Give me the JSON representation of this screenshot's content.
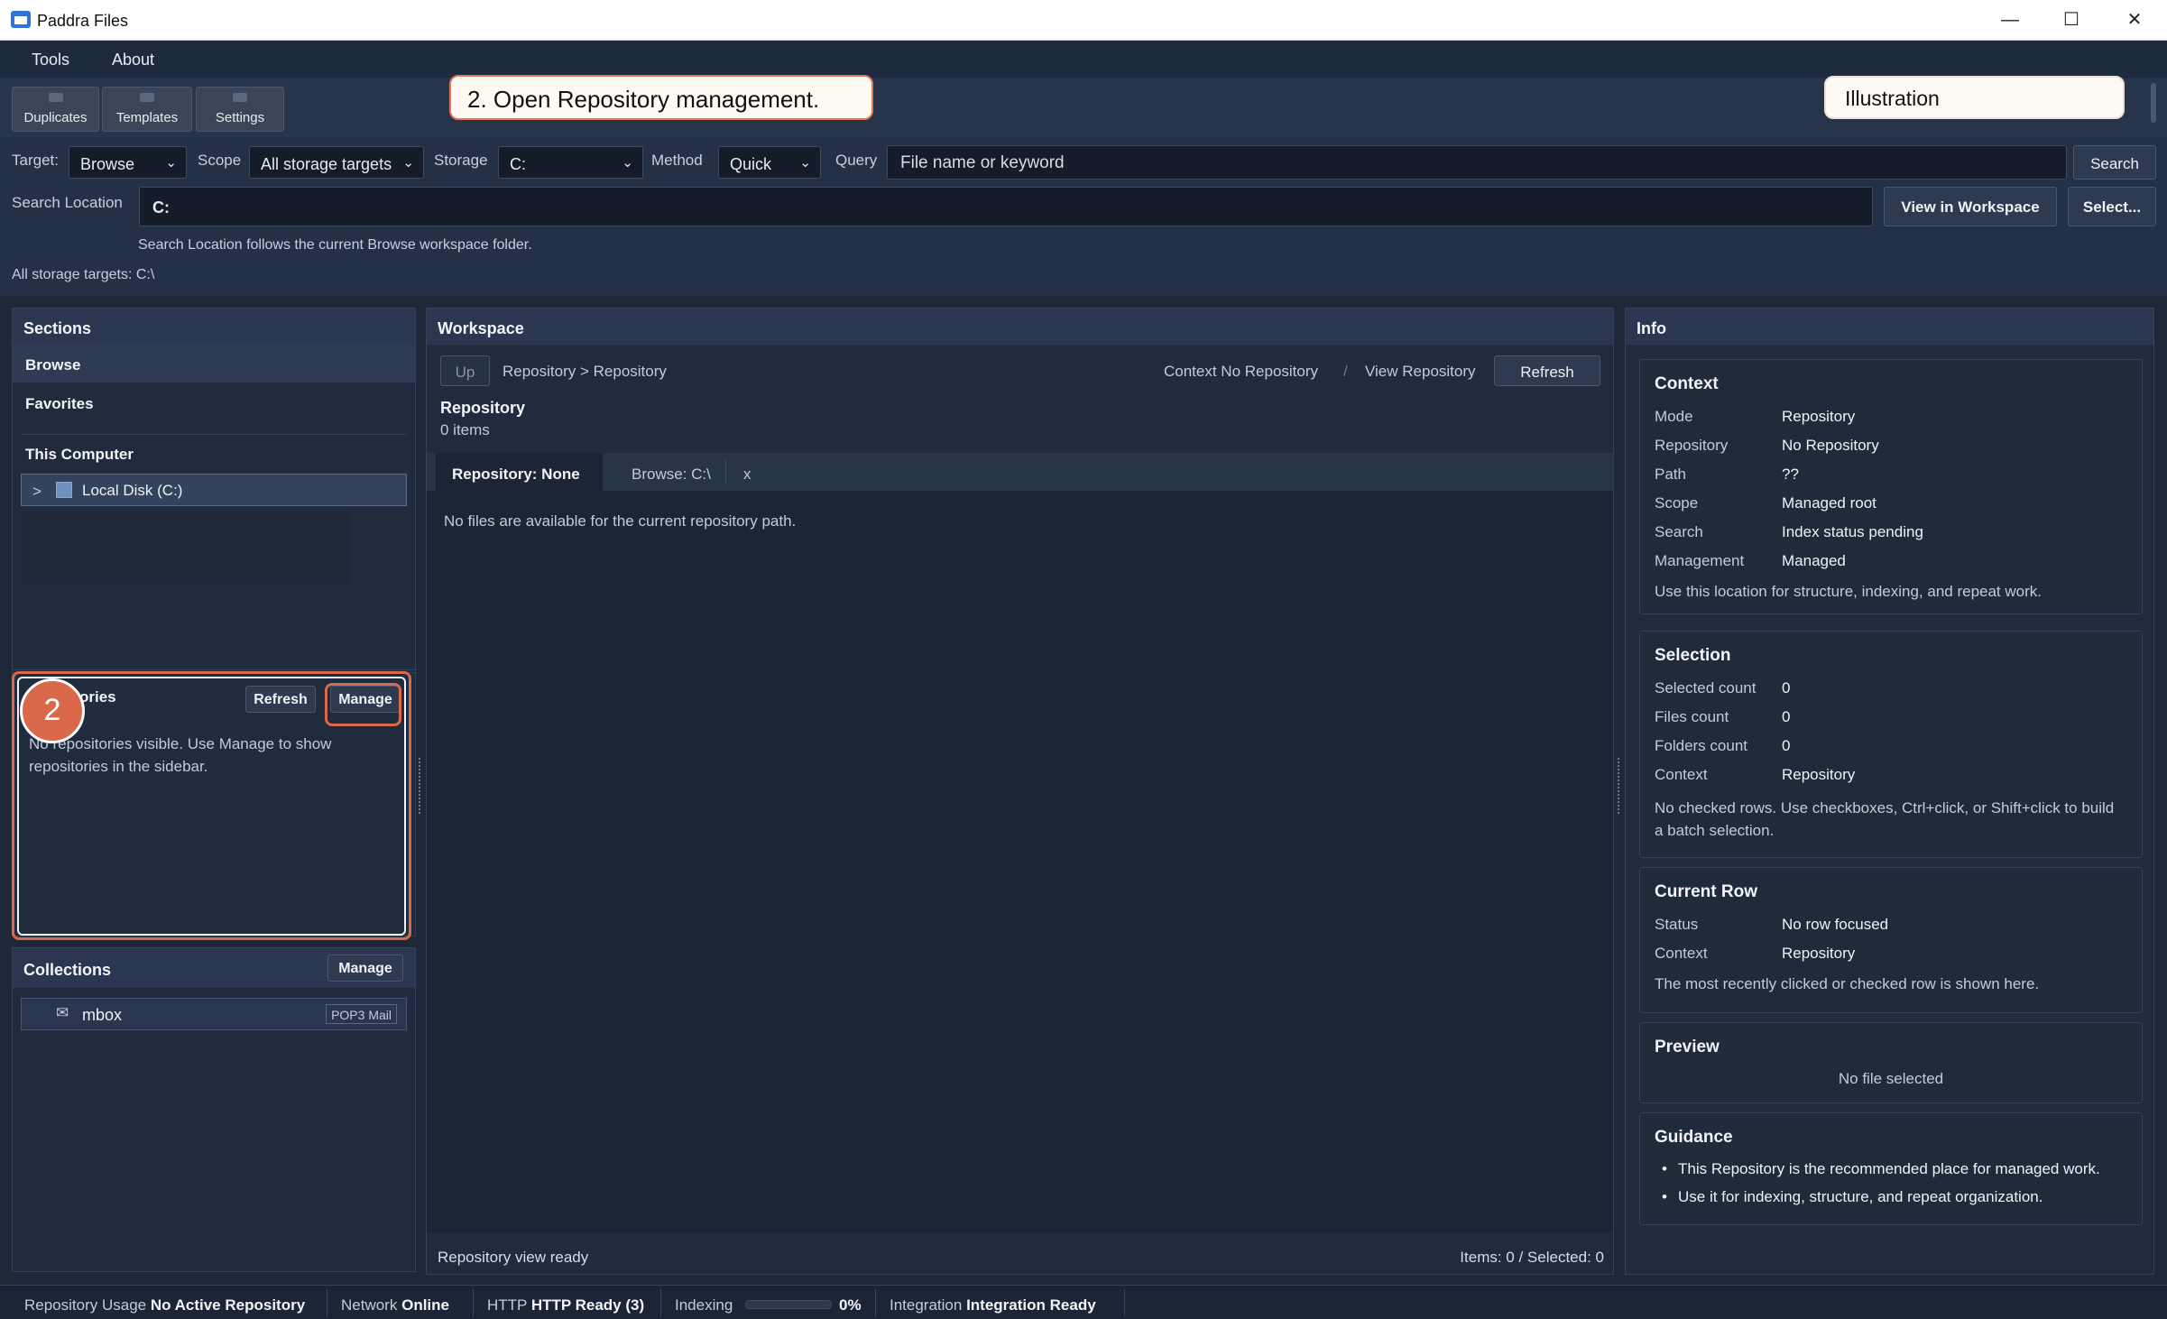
{
  "window": {
    "title": "Paddra Files",
    "controls": [
      "minimize",
      "maximize",
      "close"
    ]
  },
  "menu": {
    "items": [
      "Tools",
      "About"
    ]
  },
  "toolbar": {
    "buttons": [
      "Duplicates",
      "Templates",
      "Settings"
    ]
  },
  "callouts": {
    "step": "2. Open Repository management.",
    "illustration": "Illustration",
    "badge": "2"
  },
  "search": {
    "target_label": "Target:",
    "target_value": "Browse",
    "scope_label": "Scope",
    "scope_value": "All storage targets",
    "storage_label": "Storage",
    "storage_value": "C:",
    "method_label": "Method",
    "method_value": "Quick",
    "query_label": "Query",
    "query_placeholder": "File name or keyword",
    "search_button": "Search",
    "location_label": "Search Location",
    "location_value": "C:",
    "view_in_workspace": "View in Workspace",
    "select_button": "Select...",
    "location_note": "Search Location follows the current Browse workspace folder.",
    "all_targets_note": "All storage targets: C:\\"
  },
  "sections": {
    "header": "Sections",
    "browse": "Browse",
    "favorites": "Favorites",
    "this_computer": "This Computer",
    "local_disk": "Local Disk (C:)",
    "expand": ">"
  },
  "repositories": {
    "title_visible": "ories",
    "refresh": "Refresh",
    "manage": "Manage",
    "empty_text": "No repositories visible. Use Manage to show repositories in the sidebar."
  },
  "collections": {
    "title": "Collections",
    "manage": "Manage",
    "item_name": "mbox",
    "item_badge": "POP3 Mail"
  },
  "workspace": {
    "header": "Workspace",
    "up": "Up",
    "breadcrumb": "Repository > Repository",
    "context": "Context No Repository",
    "sep": "/",
    "view": "View Repository",
    "refresh": "Refresh",
    "title": "Repository",
    "count": "0 items",
    "tabs": [
      "Repository: None",
      "Browse: C:\\"
    ],
    "tab_close": "x",
    "empty_text": "No files are available for the current repository path.",
    "status_left": "Repository view ready",
    "status_right": "Items: 0 / Selected: 0"
  },
  "info": {
    "header": "Info",
    "context": {
      "title": "Context",
      "rows": [
        {
          "k": "Mode",
          "v": "Repository"
        },
        {
          "k": "Repository",
          "v": "No Repository"
        },
        {
          "k": "Path",
          "v": "??"
        },
        {
          "k": "Scope",
          "v": "Managed root"
        },
        {
          "k": "Search",
          "v": "Index status pending"
        },
        {
          "k": "Management",
          "v": "Managed"
        }
      ],
      "note": "Use this location for structure, indexing, and repeat work."
    },
    "selection": {
      "title": "Selection",
      "rows": [
        {
          "k": "Selected count",
          "v": "0"
        },
        {
          "k": "Files count",
          "v": "0"
        },
        {
          "k": "Folders count",
          "v": "0"
        },
        {
          "k": "Context",
          "v": "Repository"
        }
      ],
      "note": "No checked rows. Use checkboxes, Ctrl+click, or Shift+click to build a batch selection."
    },
    "current_row": {
      "title": "Current Row",
      "rows": [
        {
          "k": "Status",
          "v": "No row focused"
        },
        {
          "k": "Context",
          "v": "Repository"
        }
      ],
      "note": "The most recently clicked or checked row is shown here."
    },
    "preview": {
      "title": "Preview",
      "text": "No file selected"
    },
    "guidance": {
      "title": "Guidance",
      "bullets": [
        "This Repository is the recommended place for managed work.",
        "Use it for indexing, structure, and repeat organization."
      ]
    }
  },
  "statusbar": {
    "repo_label": "Repository Usage",
    "repo_value": "No Active Repository",
    "network_label": "Network",
    "network_value": "Online",
    "http_label": "HTTP",
    "http_value": "HTTP Ready (3)",
    "indexing_label": "Indexing",
    "indexing_value": "0%",
    "indexing_progress": 0,
    "integration_label": "Integration",
    "integration_value": "Integration Ready"
  },
  "colors": {
    "accent_callout": "#e0785a",
    "background": "#1e2838",
    "panel": "#202b3d"
  }
}
